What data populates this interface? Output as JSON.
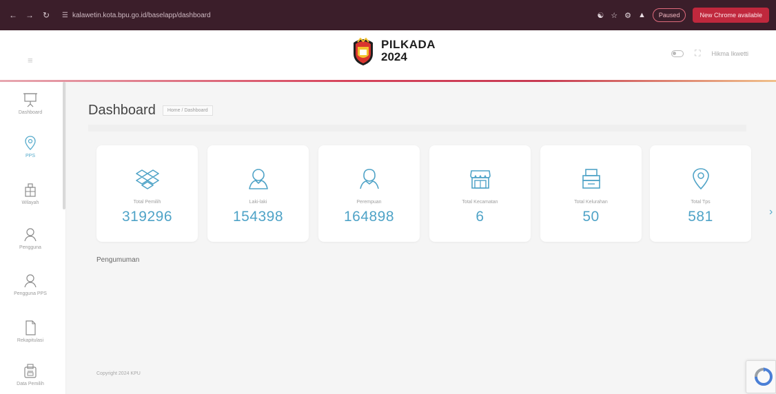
{
  "browser": {
    "url": "kalawetin.kota.bpu.go.id/baselapp/dashboard",
    "paused_label": "Paused",
    "update_label": "New Chrome available"
  },
  "header": {
    "brand_line1": "PILKADA",
    "brand_line2": "2024",
    "user_name": "Hikma Ikwetti"
  },
  "sidebar": {
    "items": [
      {
        "label": "Dashboard",
        "icon": "presentation-icon"
      },
      {
        "label": "PPS",
        "icon": "location-pin-icon",
        "active": true
      },
      {
        "label": "Wilayah",
        "icon": "building-icon"
      },
      {
        "label": "Pengguna",
        "icon": "user-icon"
      },
      {
        "label": "Pengguna PPS",
        "icon": "user-search-icon"
      },
      {
        "label": "Rekapitulasi",
        "icon": "document-icon"
      },
      {
        "label": "Data Pemilih",
        "icon": "ballot-box-icon"
      }
    ]
  },
  "page": {
    "title": "Dashboard",
    "breadcrumb": "Home / Dashboard",
    "announcement_label": "Pengumuman",
    "footer": "Copyright 2024 KPU"
  },
  "stats": [
    {
      "label": "Total Pemilih",
      "value": "319296",
      "icon": "dropbox-icon"
    },
    {
      "label": "Laki-laki",
      "value": "154398",
      "icon": "user-male-icon"
    },
    {
      "label": "Perempuan",
      "value": "164898",
      "icon": "user-female-icon"
    },
    {
      "label": "Total Kecamatan",
      "value": "6",
      "icon": "store-icon"
    },
    {
      "label": "Total Kelurahan",
      "value": "50",
      "icon": "building-stack-icon"
    },
    {
      "label": "Total Tps",
      "value": "581",
      "icon": "map-pin-icon"
    }
  ],
  "colors": {
    "accent": "#4fa3c7",
    "browser_bar": "#3b1e2a",
    "update_button": "#c0283d"
  }
}
